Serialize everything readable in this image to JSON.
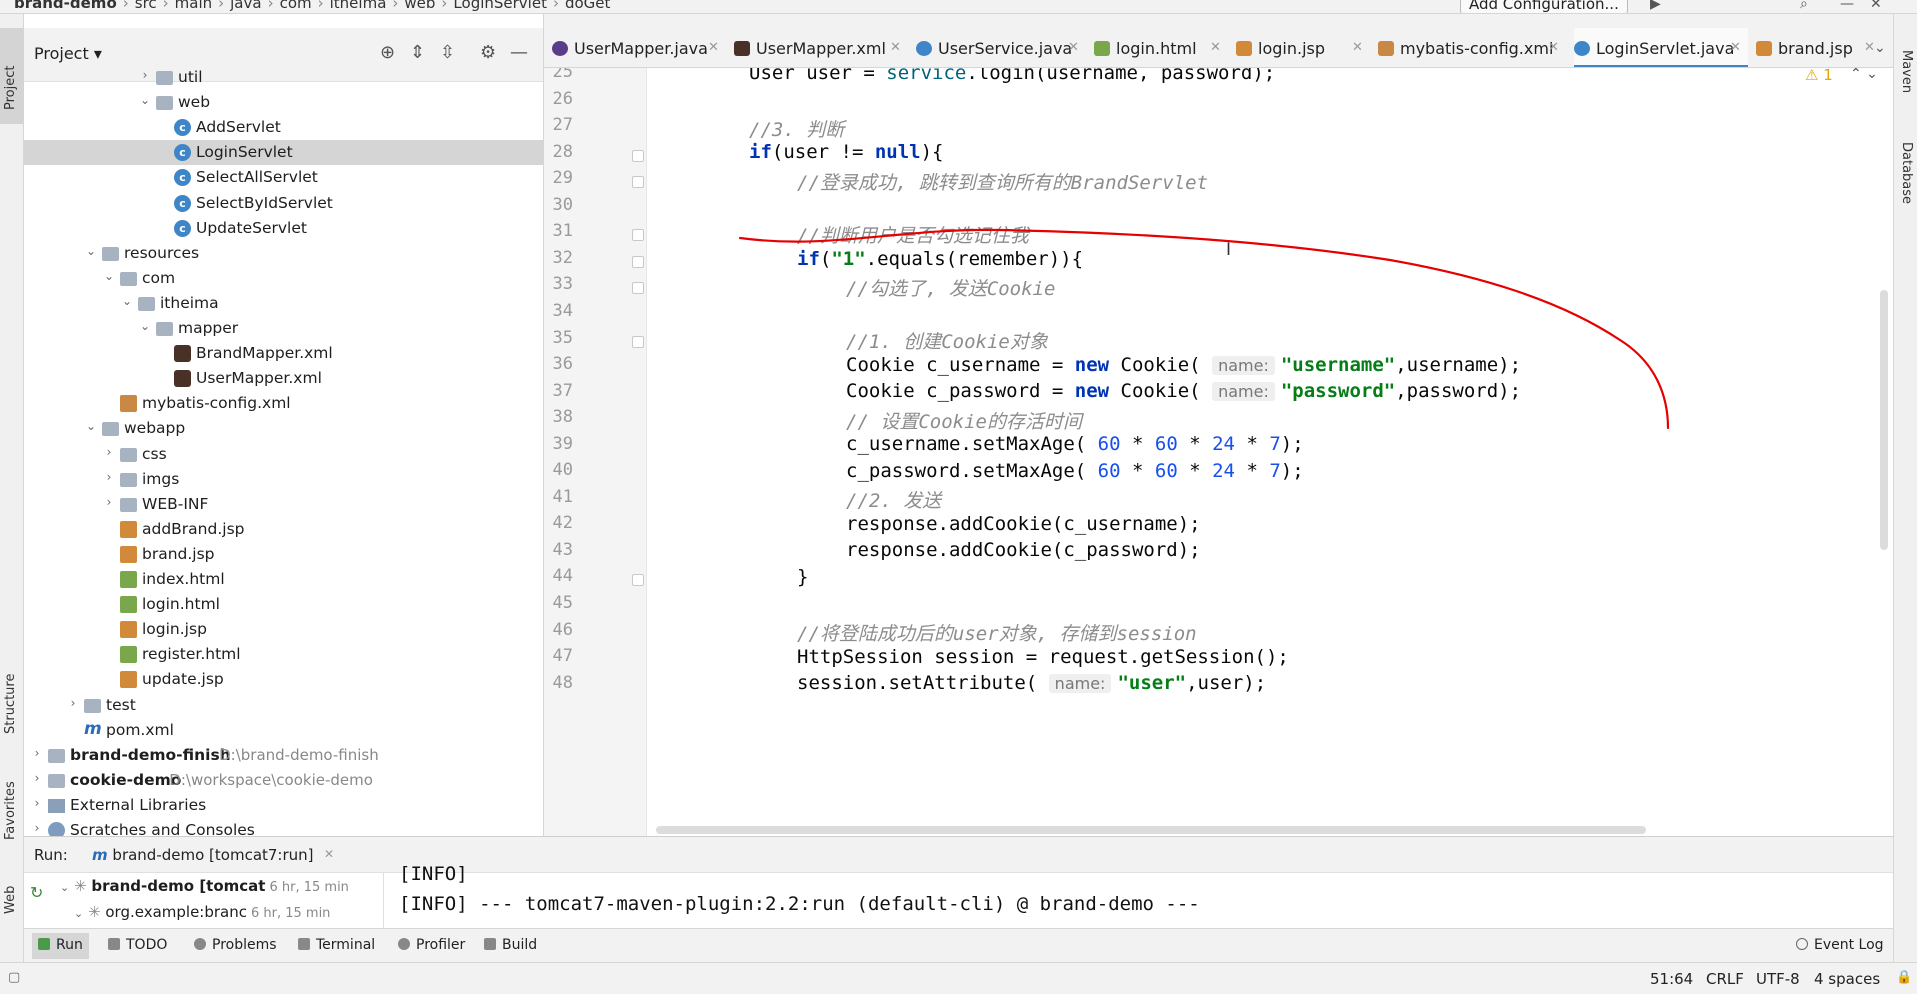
{
  "navbar": {
    "crumbs": [
      "brand-demo",
      "src",
      "main",
      "java",
      "com",
      "itheima",
      "web",
      "LoginServlet",
      "doGet"
    ],
    "add_configuration": "Add Configuration..."
  },
  "left_strip": {
    "project": "Project",
    "structure": "Structure",
    "favorites": "Favorites",
    "web": "Web"
  },
  "right_strip": {
    "maven": "Maven",
    "database": "Database"
  },
  "project_panel": {
    "title": "Project",
    "tree": [
      {
        "label": "util",
        "type": "folder",
        "depth": 6,
        "expand": "collapsed"
      },
      {
        "label": "web",
        "type": "folder",
        "depth": 6,
        "expand": "expanded"
      },
      {
        "label": "AddServlet",
        "type": "class",
        "depth": 7
      },
      {
        "label": "LoginServlet",
        "type": "class",
        "depth": 7,
        "selected": true
      },
      {
        "label": "SelectAllServlet",
        "type": "class",
        "depth": 7
      },
      {
        "label": "SelectByIdServlet",
        "type": "class",
        "depth": 7
      },
      {
        "label": "UpdateServlet",
        "type": "class",
        "depth": 7
      },
      {
        "label": "resources",
        "type": "folder",
        "depth": 3,
        "expand": "expanded"
      },
      {
        "label": "com",
        "type": "folder",
        "depth": 4,
        "expand": "expanded"
      },
      {
        "label": "itheima",
        "type": "folder",
        "depth": 5,
        "expand": "expanded"
      },
      {
        "label": "mapper",
        "type": "folder",
        "depth": 6,
        "expand": "expanded"
      },
      {
        "label": "BrandMapper.xml",
        "type": "mapperxml",
        "depth": 7
      },
      {
        "label": "UserMapper.xml",
        "type": "mapperxml",
        "depth": 7
      },
      {
        "label": "mybatis-config.xml",
        "type": "xml",
        "depth": 4
      },
      {
        "label": "webapp",
        "type": "folder",
        "depth": 3,
        "expand": "expanded"
      },
      {
        "label": "css",
        "type": "folder",
        "depth": 4,
        "expand": "collapsed"
      },
      {
        "label": "imgs",
        "type": "folder",
        "depth": 4,
        "expand": "collapsed"
      },
      {
        "label": "WEB-INF",
        "type": "folder",
        "depth": 4,
        "expand": "collapsed"
      },
      {
        "label": "addBrand.jsp",
        "type": "jsp",
        "depth": 4
      },
      {
        "label": "brand.jsp",
        "type": "jsp",
        "depth": 4
      },
      {
        "label": "index.html",
        "type": "html",
        "depth": 4
      },
      {
        "label": "login.html",
        "type": "html",
        "depth": 4
      },
      {
        "label": "login.jsp",
        "type": "jsp",
        "depth": 4
      },
      {
        "label": "register.html",
        "type": "html",
        "depth": 4
      },
      {
        "label": "update.jsp",
        "type": "jsp",
        "depth": 4
      },
      {
        "label": "test",
        "type": "folder",
        "depth": 2,
        "expand": "collapsed"
      },
      {
        "label": "pom.xml",
        "type": "pom",
        "depth": 2
      },
      {
        "label": "brand-demo-finish",
        "path": "D:\\brand-demo-finish",
        "type": "module",
        "depth": 0,
        "expand": "collapsed",
        "bold": true
      },
      {
        "label": "cookie-demo",
        "path": "D:\\workspace\\cookie-demo",
        "type": "module",
        "depth": 0,
        "expand": "collapsed",
        "bold": true
      },
      {
        "label": "External Libraries",
        "type": "lib",
        "depth": 0,
        "expand": "collapsed"
      },
      {
        "label": "Scratches and Consoles",
        "type": "scratch",
        "depth": 0,
        "expand": "collapsed"
      }
    ]
  },
  "tabs": [
    {
      "label": "UserMapper.java",
      "icon": "interface",
      "color": "#5a3d8a"
    },
    {
      "label": "UserMapper.xml",
      "icon": "mybatis",
      "color": "#4a3128"
    },
    {
      "label": "UserService.java",
      "icon": "class",
      "color": "#3e86c7"
    },
    {
      "label": "login.html",
      "icon": "html",
      "color": "#7aa64c"
    },
    {
      "label": "login.jsp",
      "icon": "jsp",
      "color": "#d08a3a"
    },
    {
      "label": "mybatis-config.xml",
      "icon": "xml",
      "color": "#c98945"
    },
    {
      "label": "LoginServlet.java",
      "icon": "class",
      "color": "#3e86c7",
      "active": true
    },
    {
      "label": "brand.jsp",
      "icon": "jsp",
      "color": "#d08a3a"
    }
  ],
  "editor": {
    "warnings": "1",
    "lines": [
      25,
      26,
      27,
      28,
      29,
      30,
      31,
      32,
      33,
      34,
      35,
      36,
      37,
      38,
      39,
      40,
      41,
      42,
      43,
      44,
      45,
      46,
      47,
      48
    ],
    "hint_name": "name:",
    "code": {
      "l25": {
        "a": "User user = ",
        "b": "service",
        "c": ".login(username, password);"
      },
      "l27": "//3. 判断",
      "l28": {
        "kw1": "if",
        "a": "(user != ",
        "kw2": "null",
        "b": "){"
      },
      "l29": "//登录成功, 跳转到查询所有的BrandServlet",
      "l31": "//判断用户是否勾选记住我",
      "l32": {
        "kw": "if",
        "a": "(",
        "s": "\"1\"",
        "b": ".equals(remember)){"
      },
      "l33": "//勾选了, 发送Cookie",
      "l35": "//1. 创建Cookie对象",
      "l36": {
        "a": "Cookie c_username = ",
        "kw": "new",
        "b": " Cookie( ",
        "s": "\"username\"",
        "c": ",username);"
      },
      "l37": {
        "a": "Cookie c_password = ",
        "kw": "new",
        "b": " Cookie( ",
        "s": "\"password\"",
        "c": ",password);"
      },
      "l38": "// 设置Cookie的存活时间",
      "l39": {
        "a": "c_username.setMaxAge( ",
        "n1": "60",
        "m1": " * ",
        "n2": "60",
        "m2": " * ",
        "n3": "24",
        "m3": " * ",
        "n4": "7",
        "b": ");"
      },
      "l40": {
        "a": "c_password.setMaxAge( ",
        "n1": "60",
        "m1": " * ",
        "n2": "60",
        "m2": " * ",
        "n3": "24",
        "m3": " * ",
        "n4": "7",
        "b": ");"
      },
      "l41": "//2. 发送",
      "l42": "response.addCookie(c_username);",
      "l43": "response.addCookie(c_password);",
      "l44": "}",
      "l46": "//将登陆成功后的user对象, 存储到session",
      "l47": "HttpSession session = request.getSession();",
      "l48": {
        "a": "session.setAttribute( ",
        "s": "\"user\"",
        "b": ",user);"
      }
    }
  },
  "run_panel": {
    "label": "Run:",
    "config": "brand-demo [tomcat7:run]",
    "tree": [
      {
        "label": "brand-demo [tomcat",
        "time": "6 hr, 15 min",
        "bold": true
      },
      {
        "label": "org.example:branc",
        "time": "6 hr, 15 min"
      }
    ],
    "console": [
      "[INFO]",
      "[INFO] --- tomcat7-maven-plugin:2.2:run (default-cli) @ brand-demo ---"
    ]
  },
  "bottom_tabs": [
    {
      "label": "Run",
      "active": true
    },
    {
      "label": "TODO"
    },
    {
      "label": "Problems"
    },
    {
      "label": "Terminal"
    },
    {
      "label": "Profiler"
    },
    {
      "label": "Build"
    }
  ],
  "status": {
    "event_log": "Event Log",
    "position": "51:64",
    "line_sep": "CRLF",
    "encoding": "UTF-8",
    "indent": "4 spaces"
  },
  "colors": {
    "keyword": "#0033b3",
    "comment": "#8c8c8c",
    "string": "#067d17",
    "number": "#1750eb",
    "annotation": "#e60000",
    "selection": "#d5d5d5"
  }
}
